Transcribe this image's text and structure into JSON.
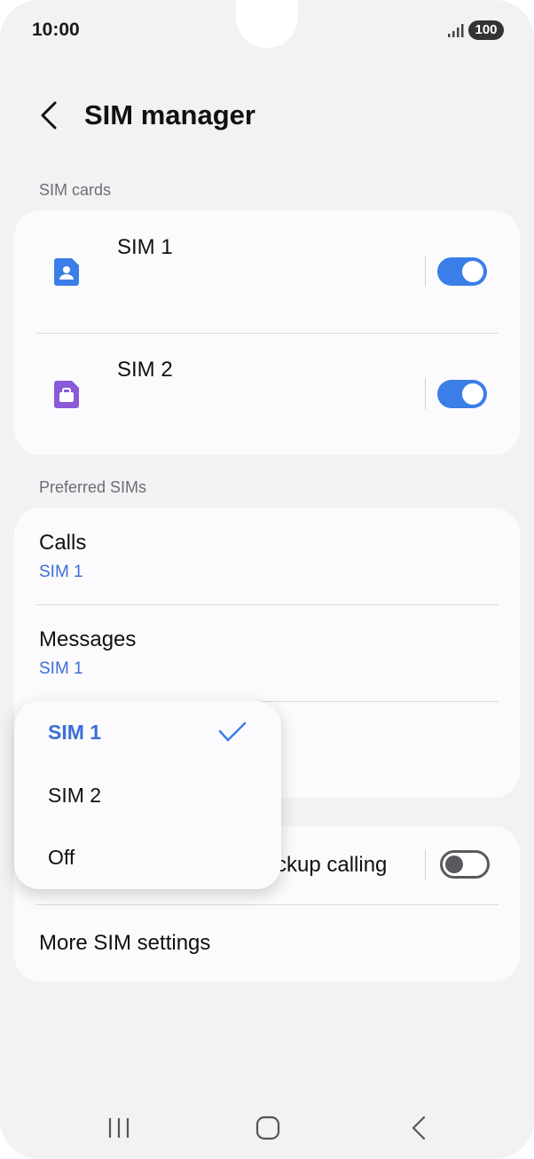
{
  "status": {
    "time": "10:00",
    "battery": "100",
    "signal_icon": "signal-icon"
  },
  "header": {
    "back_icon": "chevron-left-icon",
    "title": "SIM manager"
  },
  "sim_cards": {
    "label": "SIM cards",
    "items": [
      {
        "name": "SIM 1",
        "icon": "sim-person-icon",
        "icon_color": "#3b7ee8",
        "enabled": true
      },
      {
        "name": "SIM 2",
        "icon": "sim-briefcase-icon",
        "icon_color": "#8a5ad8",
        "enabled": true
      }
    ]
  },
  "preferred": {
    "label": "Preferred SIMs",
    "items": [
      {
        "title": "Calls",
        "value": "SIM 1"
      },
      {
        "title": "Messages",
        "value": "SIM 1"
      }
    ]
  },
  "extra": {
    "backup_calling_partial": "ckup calling",
    "backup_calling_enabled": false,
    "more_settings": "More SIM settings"
  },
  "dropdown": {
    "options": [
      {
        "label": "SIM 1",
        "selected": true
      },
      {
        "label": "SIM 2",
        "selected": false
      },
      {
        "label": "Off",
        "selected": false
      }
    ]
  },
  "colors": {
    "accent": "#3b7ee8",
    "link": "#3b6fd6",
    "sim2": "#8a5ad8",
    "background": "#f2f2f4"
  }
}
